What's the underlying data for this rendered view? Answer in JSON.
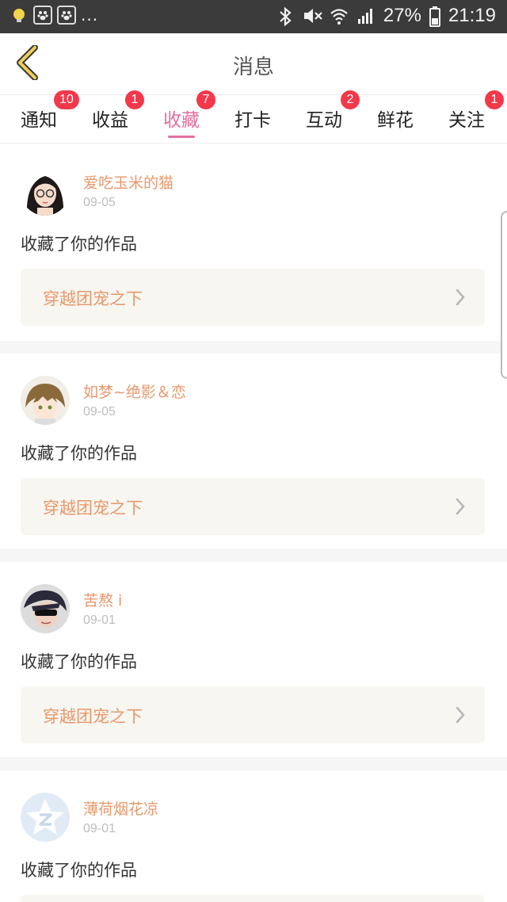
{
  "statusbar": {
    "battery": "27%",
    "time": "21:19",
    "dots": "..."
  },
  "header": {
    "title": "消息"
  },
  "tabs": [
    {
      "label": "通知",
      "badge": "10"
    },
    {
      "label": "收益",
      "badge": "1"
    },
    {
      "label": "收藏",
      "badge": "7",
      "active": true
    },
    {
      "label": "打卡",
      "badge": ""
    },
    {
      "label": "互动",
      "badge": "2"
    },
    {
      "label": "鲜花",
      "badge": ""
    },
    {
      "label": "关注",
      "badge": "1"
    }
  ],
  "items": [
    {
      "user": "爱吃玉米的猫",
      "date": "09-05",
      "action": "收藏了你的作品",
      "work": "穿越团宠之下"
    },
    {
      "user": "如梦~绝影＆恋",
      "date": "09-05",
      "action": "收藏了你的作品",
      "work": "穿越团宠之下"
    },
    {
      "user": "苦熬 i",
      "date": "09-01",
      "action": "收藏了你的作品",
      "work": "穿越团宠之下"
    },
    {
      "user": "薄荷烟花凉",
      "date": "09-01",
      "action": "收藏了你的作品",
      "work": ""
    }
  ],
  "colors": {
    "accent": "#e26fa1",
    "badge": "#f2384a",
    "username": "#e8986b",
    "back_arrow": "#e8c34a"
  }
}
